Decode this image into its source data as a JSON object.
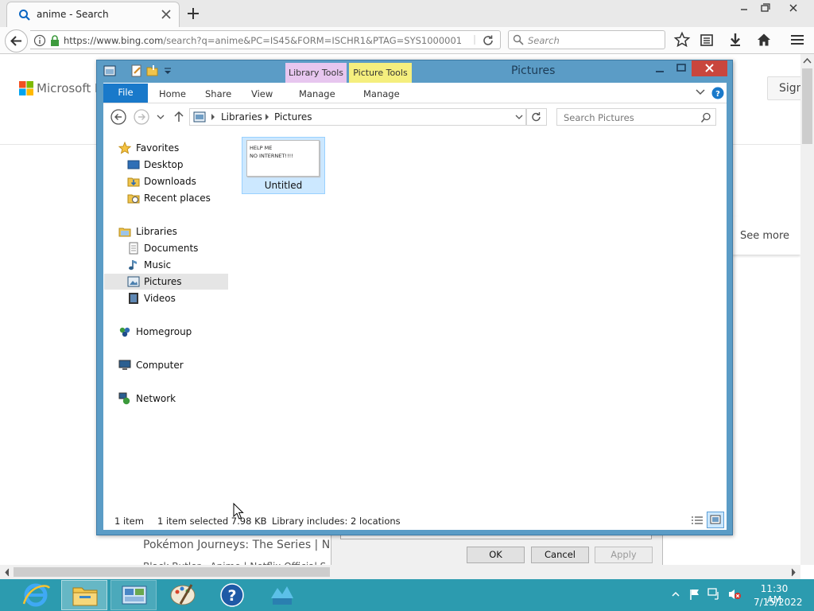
{
  "browser": {
    "tab_title": "anime - Search",
    "url_host": "https://www.bing.com",
    "url_path": "/search?q=anime&PC=IS45&FORM=ISCHR1&PTAG=SYS1000001",
    "search_placeholder": "Search"
  },
  "page": {
    "logo_text": "Microsoft Bi",
    "signin_label": "Sign",
    "see_more": "See more",
    "result_1": "Pokémon Journeys: The Series | Netf",
    "result_2": "Black Butler - Anime | Netflix Official S"
  },
  "background_dialog": {
    "ok": "OK",
    "cancel": "Cancel",
    "apply": "Apply"
  },
  "explorer": {
    "title": "Pictures",
    "context_tabs": [
      "Library Tools",
      "Picture Tools"
    ],
    "ribbon_tabs": [
      "File",
      "Home",
      "Share",
      "View",
      "Manage",
      "Manage"
    ],
    "breadcrumb": [
      "Libraries",
      "Pictures"
    ],
    "search_placeholder": "Search Pictures",
    "nav": {
      "favorites": "Favorites",
      "desktop": "Desktop",
      "downloads": "Downloads",
      "recent": "Recent places",
      "libraries": "Libraries",
      "documents": "Documents",
      "music": "Music",
      "pictures": "Pictures",
      "videos": "Videos",
      "homegroup": "Homegroup",
      "computer": "Computer",
      "network": "Network"
    },
    "file": {
      "name": "Untitled",
      "thumb_line1": "HELP ME",
      "thumb_line2": "NO INTERNET!!!!"
    },
    "status": {
      "count": "1 item",
      "selected": "1 item selected  7.98 KB",
      "library": "Library includes: 2 locations"
    }
  },
  "taskbar": {
    "time": "11:30 AM",
    "date": "7/15/2022"
  },
  "colors": {
    "explorer_frame": "#5b9cc6",
    "file_tab": "#1979ca",
    "taskbar": "#2c9baf",
    "library_tools": "#e7c6ef",
    "picture_tools": "#f5ef7e",
    "selection": "#cce8ff"
  }
}
